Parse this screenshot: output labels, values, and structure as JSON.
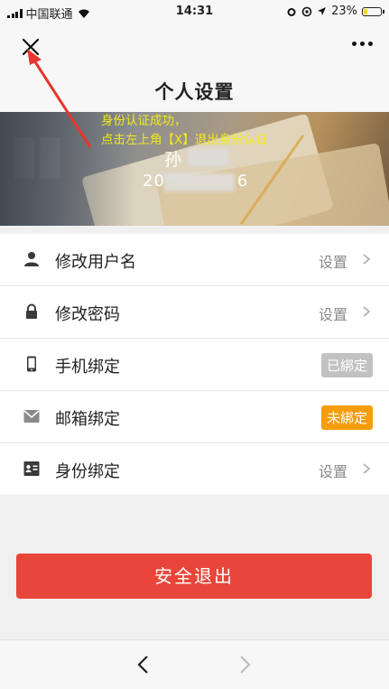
{
  "status_bar": {
    "carrier": "中国联通",
    "time": "14:31",
    "battery_percent": "23%",
    "battery_level": 0.23
  },
  "nav": {
    "title": "个人设置",
    "close_icon": "close-icon",
    "more_icon": "more-dots-icon"
  },
  "banner": {
    "name": "孙",
    "id_prefix": "20",
    "id_suffix": "6",
    "annotation_line1": "身份认证成功，",
    "annotation_line2": "点击左上角【X】退出身份认证"
  },
  "settings": [
    {
      "icon": "person-icon",
      "label": "修改用户名",
      "action": "设置"
    },
    {
      "icon": "lock-icon",
      "label": "修改密码",
      "action": "设置"
    },
    {
      "icon": "phone-icon",
      "label": "手机绑定",
      "badge": "已綁定"
    },
    {
      "icon": "mail-icon",
      "label": "邮箱绑定",
      "badge": "未綁定"
    },
    {
      "icon": "id-card-icon",
      "label": "身份绑定",
      "action": "设置"
    }
  ],
  "logout_label": "安全退出",
  "colors": {
    "logout": "#e8463a",
    "badge_bound": "#c2c2c2",
    "badge_unbound": "#f59d0d",
    "annotation": "#f3ea1b",
    "arrow": "#e8352e"
  }
}
